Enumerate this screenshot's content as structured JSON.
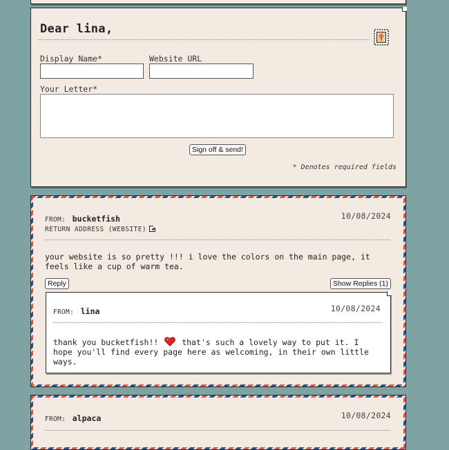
{
  "form": {
    "greeting": "Dear lina,",
    "display_name_label": "Display Name*",
    "website_label": "Website URL",
    "letter_label": "Your Letter*",
    "submit_label": "Sign off & send!",
    "required_note": "* Denotes required fields",
    "display_name_value": "",
    "website_value": "",
    "letter_value": ""
  },
  "letters": [
    {
      "from_prefix": "FROM:",
      "from_name": "bucketfish",
      "date": "10/08/2024",
      "return_address": "RETURN ADDRESS (WEBSITE)",
      "message": "your website is so pretty !!! i love the colors on the main page, it feels like a cup of warm tea.",
      "reply_label": "Reply",
      "show_replies_label": "Show Replies (1)",
      "replies": [
        {
          "from_prefix": "FROM:",
          "from_name": "lina",
          "date": "10/08/2024",
          "message_before": "thank you bucketfish!!",
          "message_after": "that's such a lovely way to put it. I hope you'll find every page here as welcoming, in their own little ways."
        }
      ]
    },
    {
      "from_prefix": "FROM:",
      "from_name": "alpaca",
      "date": "10/08/2024"
    }
  ],
  "icons": {
    "stamp": "stamp-icon",
    "external_link": "external-link-icon",
    "heart": "heart-icon"
  },
  "colors": {
    "background": "#7fa2a3",
    "paper": "#f3ebe1",
    "airmail_red": "#d9534a",
    "airmail_blue": "#2f4f8a",
    "heart": "#e0262a"
  }
}
